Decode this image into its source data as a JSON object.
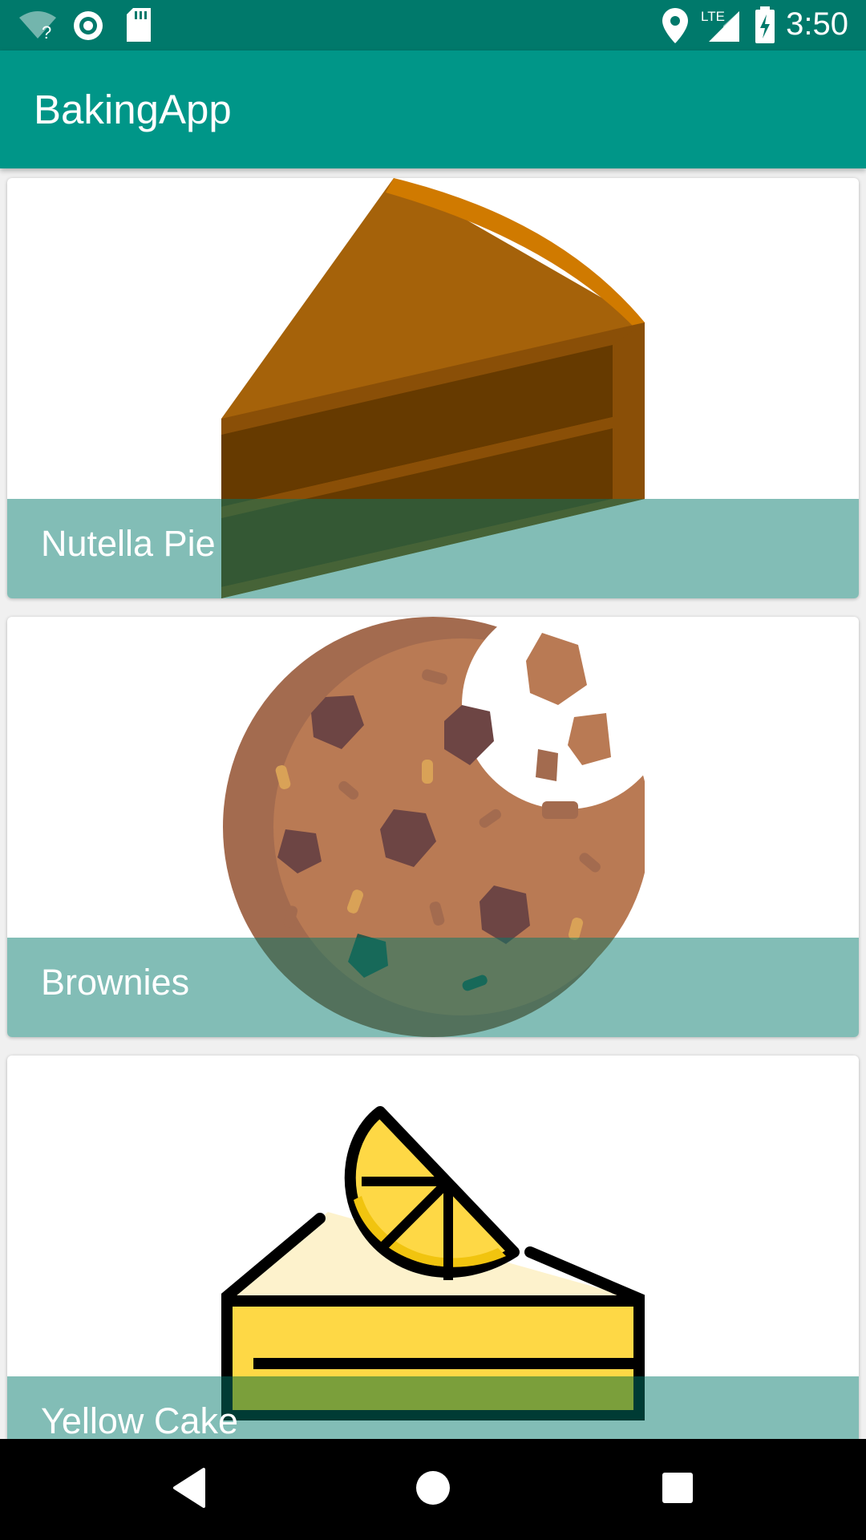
{
  "status_bar": {
    "time": "3:50",
    "icons": [
      "wifi-unknown-icon",
      "sync-icon",
      "sd-card-icon",
      "location-icon",
      "lte-signal-icon",
      "battery-charging-icon"
    ],
    "lte_label": "LTE"
  },
  "app_bar": {
    "title": "BakingApp"
  },
  "recipes": [
    {
      "name": "Nutella Pie",
      "icon": "pie-slice-icon"
    },
    {
      "name": "Brownies",
      "icon": "cookie-icon"
    },
    {
      "name": "Yellow Cake",
      "icon": "lemon-cake-icon"
    }
  ],
  "colors": {
    "status_bar": "#00796b",
    "app_bar": "#009688",
    "caption_overlay": "#00796b"
  },
  "nav_bar": {
    "buttons": [
      "back-icon",
      "home-icon",
      "recents-icon"
    ]
  }
}
